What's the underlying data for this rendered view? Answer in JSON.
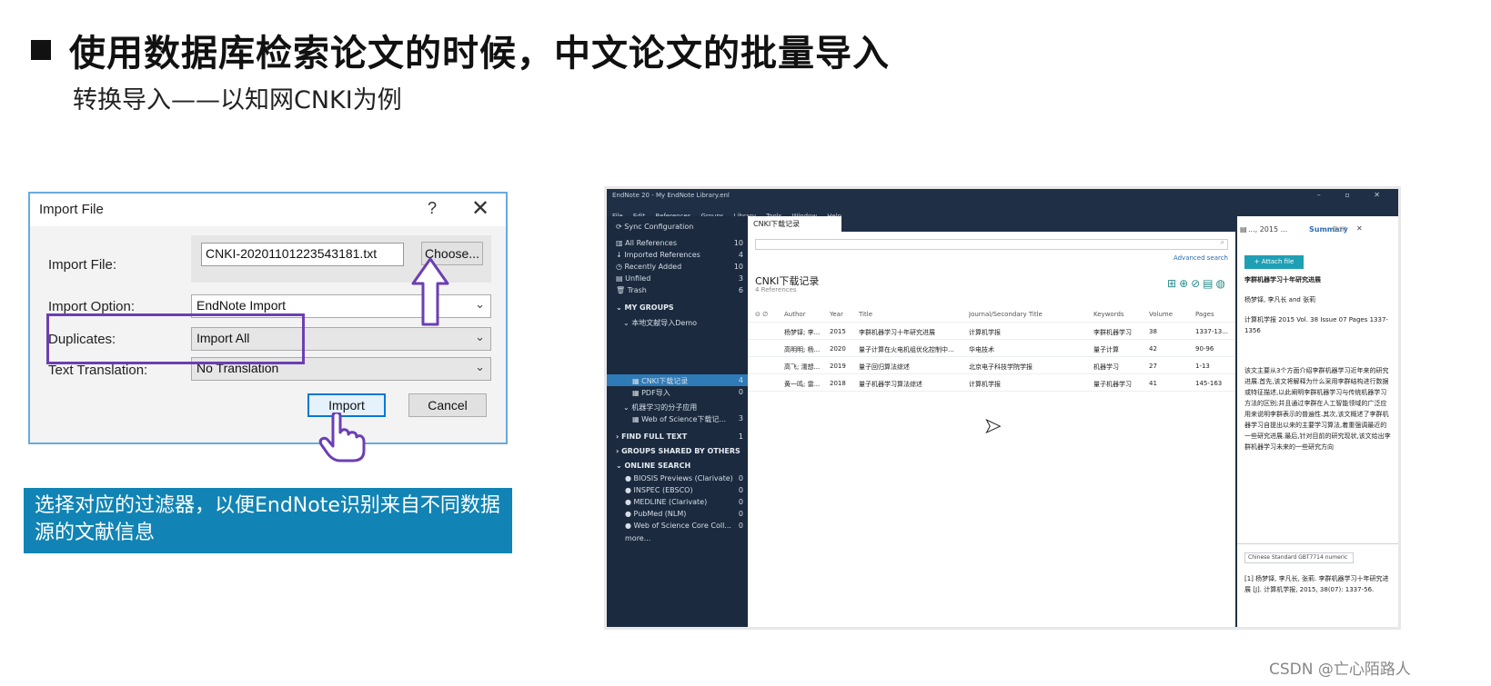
{
  "slide": {
    "title": "使用数据库检索论文的时候，中文论文的批量导入",
    "subtitle": "转换导入——以知网CNKI为例",
    "info_text": "选择对应的过滤器，以便EndNote识别来自不同数据源的文献信息",
    "watermark": "CSDN @亡心陌路人"
  },
  "import_dialog": {
    "title": "Import File",
    "help": "?",
    "close": "✕",
    "file_label": "Import File:",
    "file_value": "CNKI-20201101223543181.txt",
    "choose_label": "Choose...",
    "option_label": "Import Option:",
    "option_value": "EndNote Import",
    "duplicates_label": "Duplicates:",
    "duplicates_value": "Import All",
    "translation_label": "Text Translation:",
    "translation_value": "No Translation",
    "import_label": "Import",
    "cancel_label": "Cancel"
  },
  "endnote": {
    "app_title": "EndNote 20 - My EndNote Library.enl",
    "menu": [
      "File",
      "Edit",
      "References",
      "Groups",
      "Library",
      "Tools",
      "Window",
      "Help"
    ],
    "sidebar": {
      "sync": "Sync Configuration",
      "all_refs": {
        "label": "All References",
        "count": "10"
      },
      "imported": {
        "label": "Imported References",
        "count": "4"
      },
      "recent": {
        "label": "Recently Added",
        "count": "10"
      },
      "unfiled": {
        "label": "Unfiled",
        "count": "3"
      },
      "trash": {
        "label": "Trash",
        "count": "6"
      },
      "my_groups": "MY GROUPS",
      "group_set1": "本地文献导入Demo",
      "cnki": {
        "label": "CNKI下载记录",
        "count": "4"
      },
      "pdf": {
        "label": "PDF导入",
        "count": "0"
      },
      "group_set2": "机器学习的分子应用",
      "wos": {
        "label": "Web of Science下载记...",
        "count": "3"
      },
      "find_full_text": {
        "label": "FIND FULL TEXT",
        "count": "1"
      },
      "shared": "GROUPS SHARED BY OTHERS",
      "online": "ONLINE SEARCH",
      "biosis": {
        "label": "BIOSIS Previews (Clarivate)",
        "count": "0"
      },
      "inspec": {
        "label": "INSPEC (EBSCO)",
        "count": "0"
      },
      "medline": {
        "label": "MEDLINE (Clarivate)",
        "count": "0"
      },
      "pubmed": {
        "label": "PubMed (NLM)",
        "count": "0"
      },
      "wos_core": {
        "label": "Web of Science Core Coll...",
        "count": "0"
      },
      "more": "more..."
    },
    "tab": "CNKI下载记录",
    "advanced_search": "Advanced search",
    "group_title": "CNKI下载记录",
    "group_count": "4 References",
    "columns": {
      "author": "Author",
      "year": "Year",
      "title": "Title",
      "journal": "Journal/Secondary Title",
      "keywords": "Keywords",
      "volume": "Volume",
      "pages": "Pages"
    },
    "rows": [
      {
        "author": "杨梦铎; 李...",
        "year": "2015",
        "title": "李群机器学习十年研究进展",
        "journal": "计算机学报",
        "keywords": "李群机器学习",
        "volume": "38",
        "pages": "1337-13..."
      },
      {
        "author": "高明明; 杨...",
        "year": "2020",
        "title": "量子计算在火电机组优化控制中...",
        "journal": "华电技术",
        "keywords": "量子计算",
        "volume": "42",
        "pages": "90-96"
      },
      {
        "author": "高飞; 濡想...",
        "year": "2019",
        "title": "量子回归算法综述",
        "journal": "北京电子科技学院学报",
        "keywords": "机器学习",
        "volume": "27",
        "pages": "1-13"
      },
      {
        "author": "黄一鸣; 雷...",
        "year": "2018",
        "title": "量子机器学习算法综述",
        "journal": "计算机学报",
        "keywords": "量子机器学习",
        "volume": "41",
        "pages": "145-163"
      }
    ],
    "panel": {
      "ref_label": "..., 2015 ...",
      "summary": "Summary",
      "edit": "Edit",
      "close": "✕",
      "attach": "+ Attach file",
      "ref_title": "李群机器学习十年研究进展",
      "authors": "杨梦铎, 李凡长 and 张莉",
      "source": "计算机学报 2015 Vol. 38 Issue 07 Pages 1337-1356",
      "abstract": "该文主要从3个方面介绍李群机器学习近年来的研究进展.首先,该文将解释为什么采用李群结构进行数据或特征描述,以此阐明李群机器学习与传统机器学习方法的区别;并且通过李群在人工智能领域的广泛应用来说明李群表示的普遍性.其次,该文概述了李群机器学习自提出以来的主要学习算法,着重强调最近的一些研究进展.最后,针对目前的研究现状,该文给出李群机器学习未来的一些研究方向",
      "style": "Chinese Standard GBT7714 numeric",
      "citation": "[1]    杨梦铎, 李凡长, 张莉. 李群机器学习十年研究进展 [J]. 计算机学报, 2015, 38(07): 1337-56."
    }
  }
}
